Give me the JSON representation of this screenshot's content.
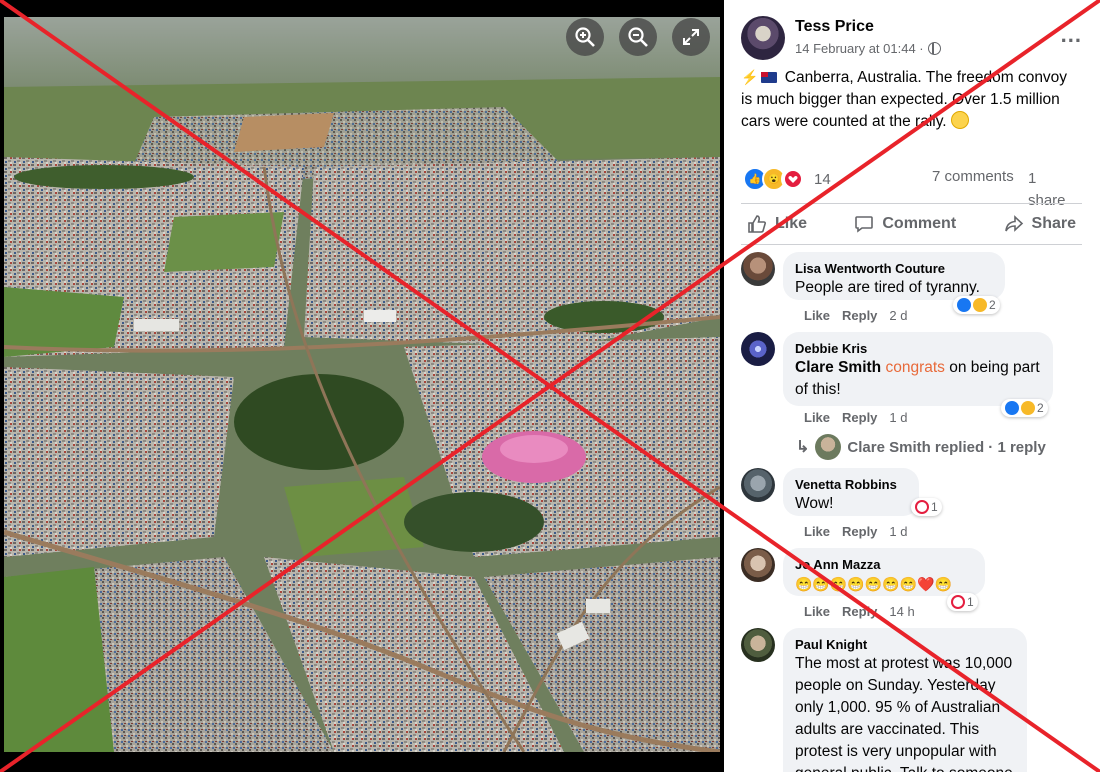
{
  "viewer": {
    "zoom_in_icon": "zoom-in-icon",
    "zoom_out_icon": "zoom-out-icon",
    "fullscreen_icon": "expand-icon",
    "photo": "aerial-photo"
  },
  "post": {
    "author": "Tess Price",
    "timestamp": "14 February at 01:44 ·",
    "privacy_icon": "globe-icon",
    "more": "...",
    "text": "Canberra, Australia. The freedom convoy is much bigger than expected. Over 1.5 million cars were counted at the rally.",
    "reaction_count": "14",
    "comments_count": "7 comments",
    "shares_count": "1 share",
    "actions": {
      "like": "Like",
      "comment": "Comment",
      "share": "Share"
    }
  },
  "comments": [
    {
      "author": "Lisa Wentworth Couture",
      "text": "People are tired of tyranny.",
      "like": "Like",
      "reply": "Reply",
      "time": "2 d",
      "reactions": "2"
    },
    {
      "author": "Debbie Kris",
      "tag": "Clare Smith",
      "highlight": "congrats",
      "text_rest": "on being part of this!",
      "like": "Like",
      "reply": "Reply",
      "time": "1 d",
      "reactions": "2",
      "replied": "Clare Smith replied · 1 reply"
    },
    {
      "author": "Venetta Robbins",
      "text": "Wow!",
      "like": "Like",
      "reply": "Reply",
      "time": "1 d",
      "reactions": "1"
    },
    {
      "author": "Jo Ann Mazza",
      "text": "😁😁😁😁😁😁😁❤️😁",
      "like": "Like",
      "reply": "Reply",
      "time": "14 h",
      "reactions": "1"
    },
    {
      "author": "Paul Knight",
      "text": "The most at protest was 10,000 people on Sunday. Yesterday only 1,000. 95 % of Australian adults are vaccinated. This protest is very unpopular with general public. Talk to someone"
    }
  ],
  "overlay": {
    "x_color": "#e8232a"
  }
}
